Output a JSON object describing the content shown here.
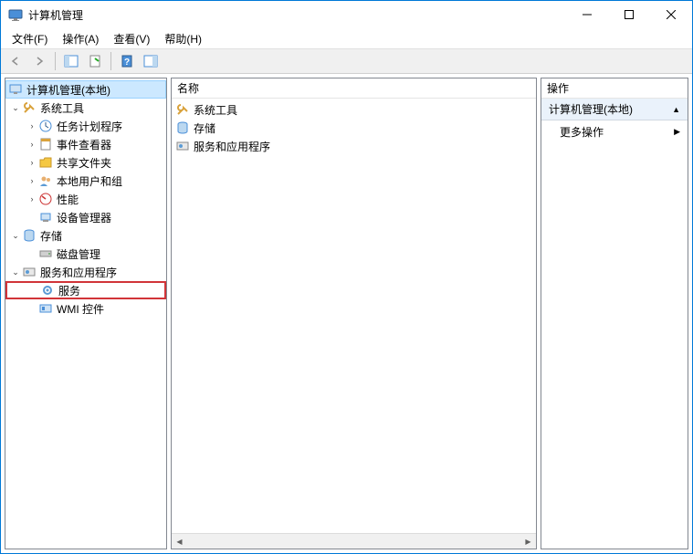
{
  "title": "计算机管理",
  "menu": {
    "file": "文件(F)",
    "action": "操作(A)",
    "view": "查看(V)",
    "help": "帮助(H)"
  },
  "tree": {
    "root": "计算机管理(本地)",
    "system_tools": "系统工具",
    "task_scheduler": "任务计划程序",
    "event_viewer": "事件查看器",
    "shared_folders": "共享文件夹",
    "local_users": "本地用户和组",
    "performance": "性能",
    "device_manager": "设备管理器",
    "storage": "存储",
    "disk_management": "磁盘管理",
    "services_apps": "服务和应用程序",
    "services": "服务",
    "wmi_control": "WMI 控件"
  },
  "list": {
    "header_name": "名称",
    "items": {
      "system_tools": "系统工具",
      "storage": "存储",
      "services_apps": "服务和应用程序"
    }
  },
  "actions": {
    "header": "操作",
    "section_label": "计算机管理(本地)",
    "more_actions": "更多操作"
  }
}
